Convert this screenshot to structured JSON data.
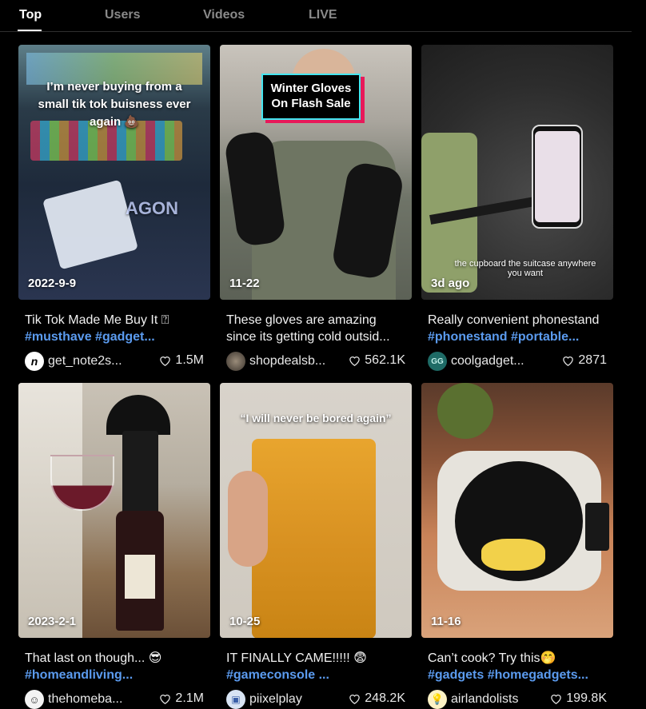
{
  "tabs": [
    {
      "label": "Top"
    },
    {
      "label": "Users"
    },
    {
      "label": "Videos"
    },
    {
      "label": "LIVE"
    }
  ],
  "videos": [
    {
      "date": "2022-9-9",
      "caption": "Tik Tok Made Me Buy It ⍰",
      "tags": "#musthave #gadget...",
      "username": "get_note2s...",
      "likes": "1.5M",
      "overlay": "I’m never buying from a small tik tok buisness ever again 💩",
      "overlay_extra": "AGON"
    },
    {
      "date": "11-22",
      "caption": "These gloves are amazing",
      "caption2": "since its getting cold outsid...",
      "username": "shopdealsb...",
      "likes": "562.1K",
      "overlay": "Winter Gloves On Flash Sale"
    },
    {
      "date": "3d ago",
      "caption": "Really convenient phonestand",
      "tags": "#phonestand #portable...",
      "username": "coolgadget...",
      "likes": "2871",
      "overlay": "the cupboard the suitcase anywhere you want"
    },
    {
      "date": "2023-2-1",
      "caption": "That last on though... 😎",
      "tags": "#homeandliving...",
      "username": "thehomeba...",
      "likes": "2.1M"
    },
    {
      "date": "10-25",
      "caption": "IT FINALLY CAME!!!!! 😨",
      "tags": "#gameconsole ...",
      "username": "piixelplay",
      "likes": "248.2K",
      "overlay": "“I will never be bored again”"
    },
    {
      "date": "11-16",
      "caption": "Can’t cook? Try this🤭",
      "tags": "#gadgets #homegadgets...",
      "username": "airlandolists",
      "likes": "199.8K"
    }
  ],
  "colors": {
    "accent_tag": "#5b9bef",
    "background": "#000000",
    "tab_inactive": "#8a8a8a"
  },
  "icons": {
    "like": "heart-outline-icon"
  }
}
